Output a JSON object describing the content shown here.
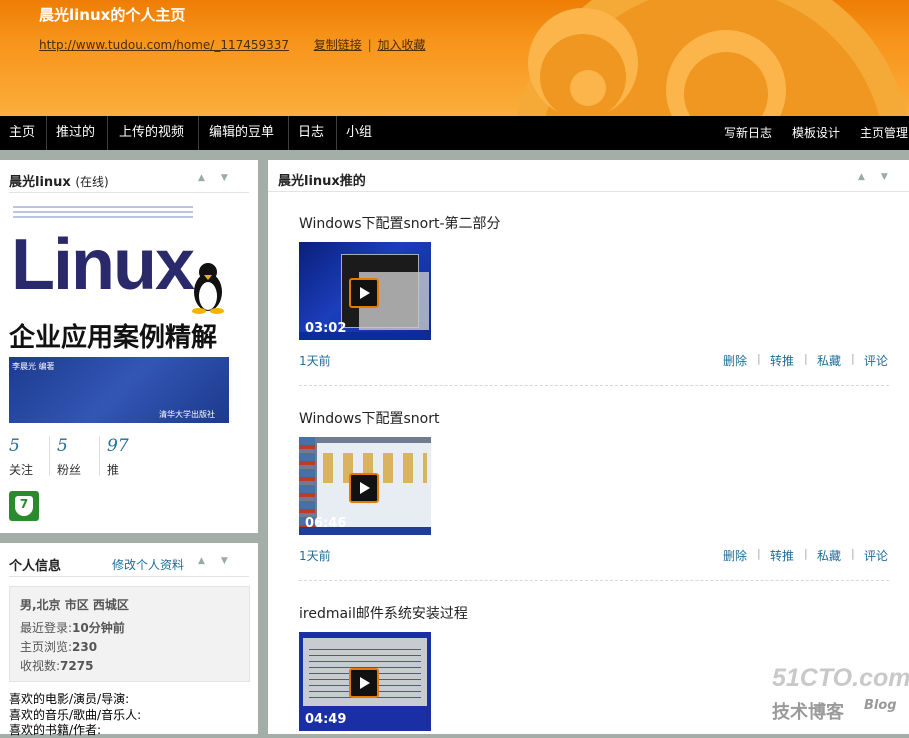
{
  "header": {
    "title": "晨光linux的个人主页",
    "url": "http://www.tudou.com/home/_117459337",
    "copy_link": "复制链接",
    "divider": "|",
    "add_fav": "加入收藏"
  },
  "nav": {
    "items": [
      "主页",
      "推过的",
      "上传的视频",
      "编辑的豆单",
      "日志",
      "小组"
    ],
    "right": [
      "写新日志",
      "模板设计",
      "主页管理"
    ]
  },
  "profile": {
    "name": "晨光linux",
    "status": "(在线)",
    "book": {
      "big": "Linux",
      "sub": "企业应用案例精解",
      "author": "李晨光 编著",
      "publisher": "清华大学出版社"
    },
    "stats": [
      {
        "num": "5",
        "label": "关注"
      },
      {
        "num": "5",
        "label": "粉丝"
      },
      {
        "num": "97",
        "label": "推"
      }
    ],
    "badge": "7"
  },
  "info": {
    "title": "个人信息",
    "edit": "修改个人资料",
    "gender_loc": "男,北京 市区 西城区",
    "rows": [
      {
        "k": "最近登录:",
        "v": "10分钟前"
      },
      {
        "k": "主页浏览:",
        "v": "230"
      },
      {
        "k": "收视数:",
        "v": "7275"
      }
    ],
    "likes": [
      "喜欢的电影/演员/导演:",
      "喜欢的音乐/歌曲/音乐人:",
      "喜欢的书籍/作者:"
    ]
  },
  "main": {
    "title": "晨光linux推的",
    "videos": [
      {
        "title": "Windows下配置snort-第二部分",
        "duration": "03:02",
        "ago": "1天前"
      },
      {
        "title": "Windows下配置snort",
        "duration": "06:46",
        "ago": "1天前"
      },
      {
        "title": "iredmail邮件系统安装过程",
        "duration": "04:49",
        "ago": ""
      }
    ],
    "actions": [
      "删除",
      "转推",
      "私藏",
      "评论"
    ],
    "action_sep": "|"
  },
  "watermark": {
    "top": "51CTO.com",
    "left": "技术博客",
    "right": "Blog"
  },
  "colors": {
    "header": "#f7941a",
    "nav": "#000000",
    "link": "#1e6d97",
    "badge": "#2c8a2e"
  }
}
